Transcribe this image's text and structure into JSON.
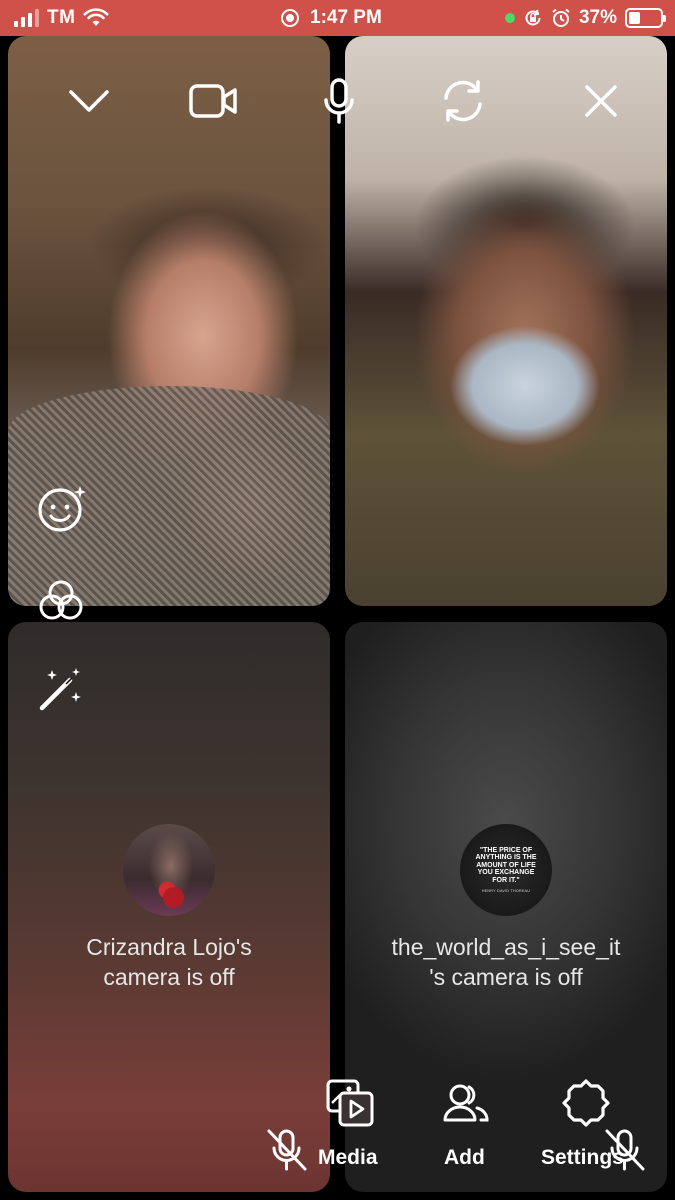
{
  "status_bar": {
    "carrier": "TM",
    "time": "1:47 PM",
    "battery_percent": "37%",
    "battery_level": 0.37
  },
  "participants": [
    {
      "name": "Crizandra Lojo",
      "camera_off_text_line1": "Crizandra Lojo's",
      "camera_off_text_line2": "camera is off"
    },
    {
      "name": "the_world_as_i_see_it",
      "camera_off_text_line1": "the_world_as_i_see_it",
      "camera_off_text_line2": "'s camera is off"
    }
  ],
  "avatar_quote": {
    "text": "\"THE PRICE OF ANYTHING IS THE AMOUNT OF LIFE YOU EXCHANGE FOR IT.\"",
    "author": "HENRY DAVID THOREAU"
  },
  "top_controls": [
    "chevron-down-icon",
    "video-camera-icon",
    "microphone-icon",
    "switch-camera-icon",
    "close-icon"
  ],
  "effects": [
    "face-effects-icon",
    "filters-icon",
    "magic-wand-icon"
  ],
  "bottom_bar": {
    "media_label": "Media",
    "add_label": "Add",
    "settings_label": "Settings"
  },
  "colors": {
    "status_bar": "#d0504a",
    "background": "#000000"
  }
}
